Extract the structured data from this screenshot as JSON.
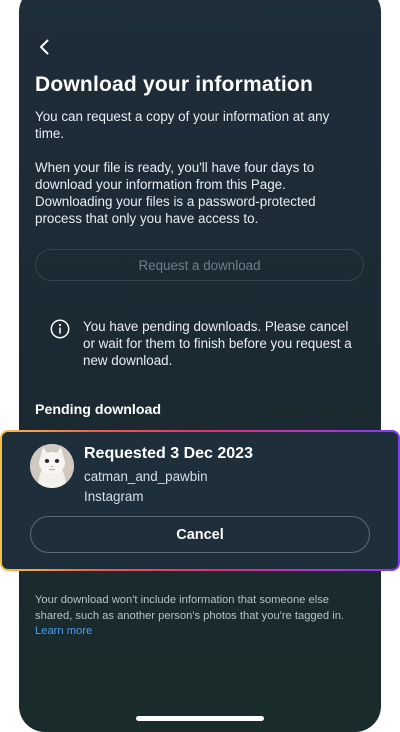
{
  "screen": {
    "title": "Download your information",
    "intro": "You can request a copy of your information at any time.",
    "details": "When your file is ready, you'll have four days to download your information from this Page. Downloading your files is a password-protected process that only you have access to."
  },
  "request_button": {
    "label": "Request a download",
    "enabled": false
  },
  "notice": {
    "icon": "info-icon",
    "text": "You have pending downloads. Please cancel or wait for them to finish before you request a new download."
  },
  "pending": {
    "section_title": "Pending download",
    "item": {
      "requested": "Requested 3 Dec 2023",
      "username": "catman_and_pawbin",
      "app": "Instagram",
      "avatar": "cat-avatar",
      "cancel_label": "Cancel"
    }
  },
  "footer": {
    "note": "Your download won't include information that someone else shared, such as another person's photos that you're tagged in.",
    "link": "Learn more"
  },
  "colors": {
    "background_top": "#1f2d3b",
    "background_bottom": "#1a2b2b",
    "card_background": "#1f2e3b",
    "link": "#4a9df0",
    "border_gradient": [
      "#f7c04a",
      "#ee5a4e",
      "#dc2e7c",
      "#b334c7",
      "#7c3cf0"
    ]
  }
}
